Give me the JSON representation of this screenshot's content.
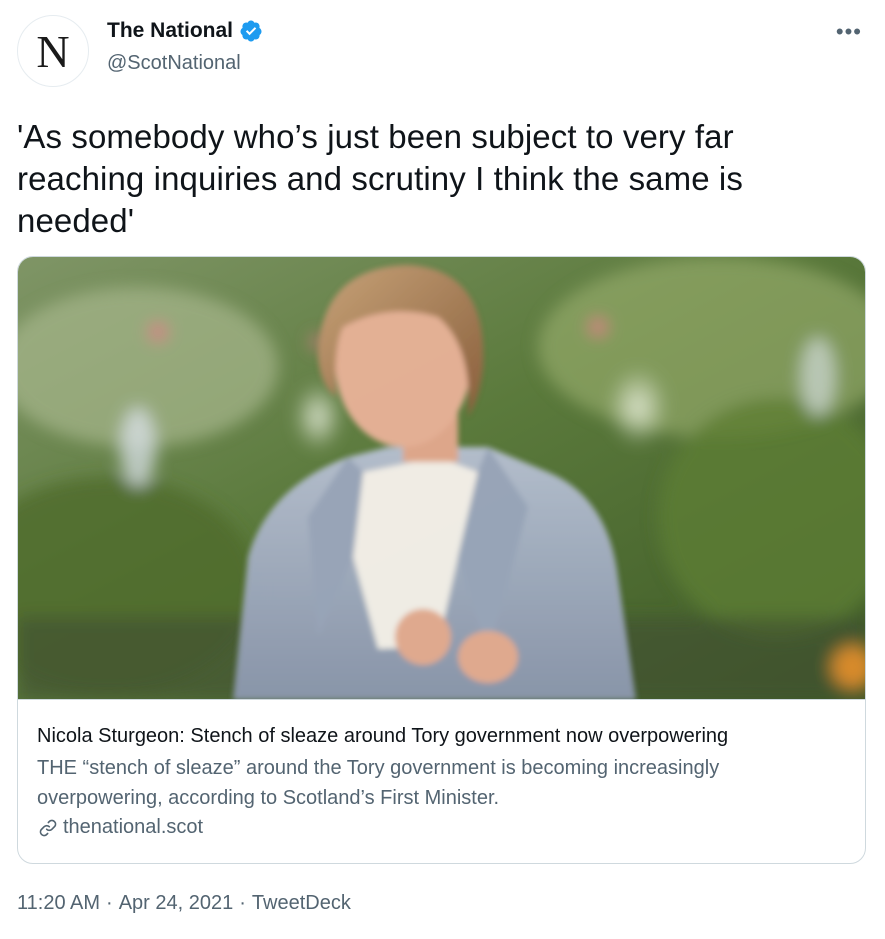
{
  "author": {
    "avatar_letter": "N",
    "display_name": "The National",
    "handle": "@ScotNational",
    "verified": true
  },
  "more_menu": "•••",
  "tweet": {
    "text": "'As somebody who’s just been subject to very far reaching inquiries and scrutiny I think the same is needed'"
  },
  "card": {
    "title": "Nicola Sturgeon: Stench of sleaze around Tory government now overpowering",
    "description": "THE “stench of sleaze” around the Tory government is becoming increasingly overpowering, according to Scotland’s First Minister.",
    "domain": "thenational.scot"
  },
  "meta": {
    "time": "11:20 AM",
    "date": "Apr 24, 2021",
    "source": "TweetDeck",
    "separator": "·"
  },
  "colors": {
    "verified_blue": "#1d9bf0",
    "secondary_text": "#536471",
    "border": "#cfd9de"
  }
}
